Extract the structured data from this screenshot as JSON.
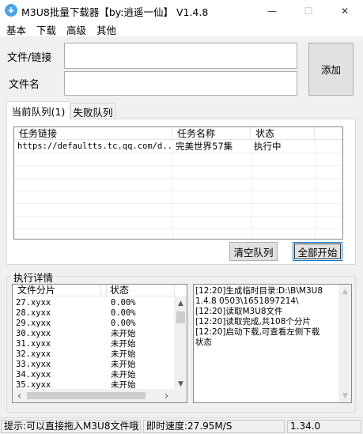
{
  "window": {
    "title": "M3U8批量下载器【by:逍遥一仙】 V1.4.8",
    "minimize_glyph": "—",
    "maximize_glyph": "☐",
    "close_glyph": "✕"
  },
  "menu": [
    "基本",
    "下载",
    "高级",
    "其他"
  ],
  "form": {
    "file_label": "文件/链接",
    "file_value": "",
    "name_label": "文件名",
    "name_value": "",
    "add_button": "添加"
  },
  "tabs": [
    {
      "label": "当前队列(1)",
      "active": true
    },
    {
      "label": "失败队列",
      "active": false
    }
  ],
  "queue": {
    "columns": [
      "任务链接",
      "任务名称",
      "状态"
    ],
    "rows": [
      {
        "link": "https://defaultts.tc.qq.com/d...",
        "name": "完美世界57集",
        "status": "执行中"
      }
    ],
    "clear_button": "清空队列",
    "start_button": "全部开始"
  },
  "details": {
    "title": "执行详情",
    "file_columns": [
      "文件分片",
      "状态"
    ],
    "segments": [
      {
        "name": "27.xyxx",
        "status": "0.00%"
      },
      {
        "name": "28.xyxx",
        "status": "0.00%"
      },
      {
        "name": "29.xyxx",
        "status": "0.00%"
      },
      {
        "name": "30.xyxx",
        "status": "未开始"
      },
      {
        "name": "31.xyxx",
        "status": "未开始"
      },
      {
        "name": "32.xyxx",
        "status": "未开始"
      },
      {
        "name": "33.xyxx",
        "status": "未开始"
      },
      {
        "name": "34.xyxx",
        "status": "未开始"
      },
      {
        "name": "35.xyxx",
        "status": "未开始"
      }
    ],
    "log_lines": [
      "[12:20]生成临时目录:D:\\B\\M3U8",
      "1.4.8 0503\\1651897214\\",
      "[12:20]读取M3U8文件",
      "[12:20]读取完成,共108个分片",
      "[12:20]启动下载,可查看左侧下载",
      "状态"
    ]
  },
  "icons": {
    "app": "download-arrow-icon",
    "scroll_up": "▲",
    "scroll_down": "▼",
    "scroll_left": "‹",
    "scroll_right": "›"
  },
  "status": {
    "hint": "提示:可以直接拖入M3U8文件哦",
    "speed": "即时速度:27.95M/S",
    "version": "1.34.0"
  },
  "colors": {
    "accent": "#0078d7",
    "app_icon": "#4aa3e6"
  }
}
